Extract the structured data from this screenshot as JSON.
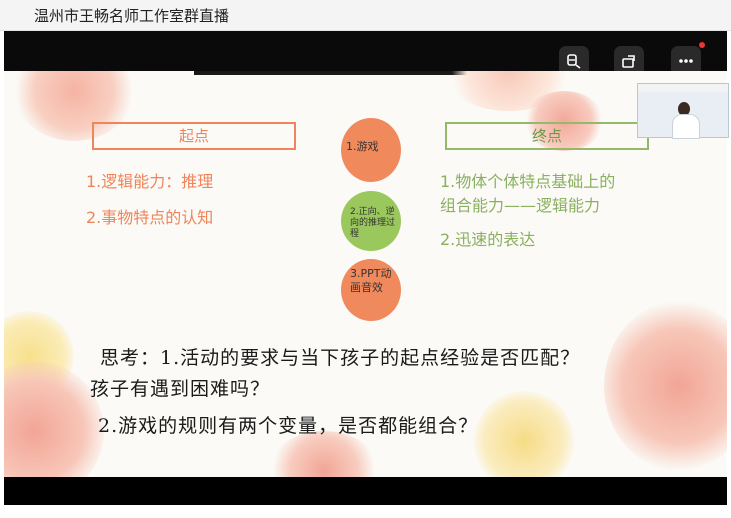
{
  "window": {
    "title": "温州市王畅名师工作室群直播"
  },
  "controls": {
    "buttons": [
      "captions-icon",
      "rotate-icon",
      "more-icon"
    ]
  },
  "slide": {
    "left_box": {
      "label": "起点",
      "items": [
        "1.逻辑能力：推理",
        "2.事物特点的认知"
      ]
    },
    "right_box": {
      "label": "终点",
      "items": [
        "1.物体个体特点基础上的",
        "组合能力——逻辑能力",
        "2.迅速的表达"
      ]
    },
    "circles": [
      "1.游戏",
      "2.正向、逆向的推理过程",
      "3.PPT动画音效"
    ],
    "think_lines": [
      "思考：1.活动的要求与当下孩子的起点经验是否匹配？",
      "孩子有遇到困难吗？",
      "2.游戏的规则有两个变量，是否都能组合？"
    ]
  },
  "colors": {
    "orange": "#f0845a",
    "green": "#95b86b",
    "circle_orange": "#f08a5d",
    "circle_green": "#9bc85c"
  }
}
